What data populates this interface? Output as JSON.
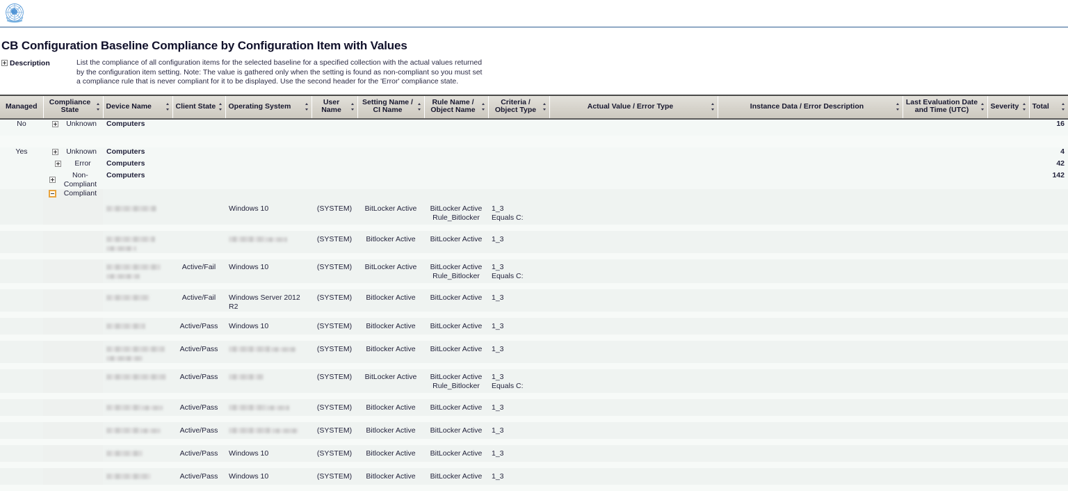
{
  "branding": {
    "logo_icon": "un-emblem-logo",
    "logo_alt": "United Nations emblem"
  },
  "report": {
    "title": "CB Configuration Baseline Compliance by Configuration Item with Values",
    "description_label": "Description",
    "description_expander_icon": "plus-box-icon",
    "description_text": "List the compliance of all configuration items for the selected baseline for a specified collection with the actual values returned by the configuration item setting. Note: The value is gathered only when the setting is found as non-compliant so you must set a compliance rule that is never compliant for it to be displayed. Use the second header for the 'Error' compliance state."
  },
  "grid": {
    "sort_icon": "sort-updown-icon",
    "columns": [
      {
        "key": "managed",
        "label": "Managed",
        "sortable": false
      },
      {
        "key": "state",
        "label": "Compliance State",
        "sortable": true
      },
      {
        "key": "device",
        "label": "Device Name",
        "sortable": true
      },
      {
        "key": "client",
        "label": "Client State",
        "sortable": true
      },
      {
        "key": "os",
        "label": "Operating System",
        "sortable": true
      },
      {
        "key": "user",
        "label": "User Name",
        "sortable": true
      },
      {
        "key": "setting",
        "label": "Setting Name / CI Name",
        "sortable": true
      },
      {
        "key": "rule",
        "label": "Rule Name / Object Name",
        "sortable": true
      },
      {
        "key": "criteria",
        "label": "Criteria / Object Type",
        "sortable": true
      },
      {
        "key": "actual",
        "label": "Actual Value / Error Type",
        "sortable": true
      },
      {
        "key": "instance",
        "label": "Instance Data / Error Description",
        "sortable": true
      },
      {
        "key": "lasteval",
        "label": "Last Evaluation Date and Time (UTC)",
        "sortable": true
      },
      {
        "key": "severity",
        "label": "Severity",
        "sortable": true
      },
      {
        "key": "total",
        "label": "Total",
        "sortable": true
      }
    ],
    "group_rows": [
      {
        "managed": "No",
        "toggle": "plus",
        "state": "Unknown",
        "device": "Computers",
        "total": "16"
      },
      {
        "managed": "Yes",
        "toggle": "plus",
        "state": "Unknown",
        "device": "Computers",
        "total": "4"
      },
      {
        "managed": "",
        "toggle": "plus",
        "state": "Error",
        "device": "Computers",
        "total": "42"
      },
      {
        "managed": "",
        "toggle": "plus",
        "state": "Non-Compliant",
        "device": "Computers",
        "total": "142"
      },
      {
        "managed": "",
        "toggle": "minus-selected",
        "state": "Compliant",
        "device": "",
        "total": ""
      }
    ],
    "detail_rows": [
      {
        "device": "redacted",
        "client": "",
        "os": "Windows 10",
        "user": "(SYSTEM)",
        "setting": "BitLocker Active",
        "rule": "BitLocker Active",
        "rule2": "Rule_Bitlocker",
        "criteria": "1_3",
        "criteria2": "Equals C:",
        "actual": "",
        "instance": "",
        "lasteval": "",
        "severity": "",
        "total": ""
      },
      {
        "device": "redacted",
        "client": "",
        "os": "redacted",
        "user": "(SYSTEM)",
        "setting": "Bitlocker Active",
        "rule": "BitLocker Active",
        "rule2": "",
        "criteria": "1_3",
        "criteria2": "",
        "actual": "",
        "instance": "",
        "lasteval": "",
        "severity": "",
        "total": ""
      },
      {
        "device": "redacted",
        "client": "Active/Fail",
        "os": "Windows 10",
        "user": "(SYSTEM)",
        "setting": "BitLocker Active",
        "rule": "BitLocker Active",
        "rule2": "Rule_Bitlocker",
        "criteria": "1_3",
        "criteria2": "Equals C:",
        "actual": "",
        "instance": "",
        "lasteval": "",
        "severity": "",
        "total": ""
      },
      {
        "device": "redacted",
        "client": "Active/Fail",
        "os": "Windows Server 2012 R2",
        "user": "(SYSTEM)",
        "setting": "Bitlocker Active",
        "rule": "BitLocker Active",
        "rule2": "",
        "criteria": "1_3",
        "criteria2": "",
        "actual": "",
        "instance": "",
        "lasteval": "",
        "severity": "",
        "total": ""
      },
      {
        "device": "redacted",
        "client": "Active/Pass",
        "os": "Windows 10",
        "user": "(SYSTEM)",
        "setting": "Bitlocker Active",
        "rule": "BitLocker Active",
        "rule2": "",
        "criteria": "1_3",
        "criteria2": "",
        "actual": "",
        "instance": "",
        "lasteval": "",
        "severity": "",
        "total": ""
      },
      {
        "device": "redacted",
        "client": "Active/Pass",
        "os": "redacted",
        "user": "(SYSTEM)",
        "setting": "Bitlocker Active",
        "rule": "BitLocker Active",
        "rule2": "",
        "criteria": "1_3",
        "criteria2": "",
        "actual": "",
        "instance": "",
        "lasteval": "",
        "severity": "",
        "total": ""
      },
      {
        "device": "redacted",
        "client": "Active/Pass",
        "os": "redacted",
        "user": "(SYSTEM)",
        "setting": "BitLocker Active",
        "rule": "BitLocker Active",
        "rule2": "Rule_Bitlocker",
        "criteria": "1_3",
        "criteria2": "Equals C:",
        "actual": "",
        "instance": "",
        "lasteval": "",
        "severity": "",
        "total": ""
      },
      {
        "device": "redacted",
        "client": "Active/Pass",
        "os": "redacted",
        "user": "(SYSTEM)",
        "setting": "Bitlocker Active",
        "rule": "BitLocker Active",
        "rule2": "",
        "criteria": "1_3",
        "criteria2": "",
        "actual": "",
        "instance": "",
        "lasteval": "",
        "severity": "",
        "total": ""
      },
      {
        "device": "redacted",
        "client": "Active/Pass",
        "os": "redacted",
        "user": "(SYSTEM)",
        "setting": "Bitlocker Active",
        "rule": "BitLocker Active",
        "rule2": "",
        "criteria": "1_3",
        "criteria2": "",
        "actual": "",
        "instance": "",
        "lasteval": "",
        "severity": "",
        "total": ""
      },
      {
        "device": "redacted",
        "client": "Active/Pass",
        "os": "Windows 10",
        "user": "(SYSTEM)",
        "setting": "Bitlocker Active",
        "rule": "BitLocker Active",
        "rule2": "",
        "criteria": "1_3",
        "criteria2": "",
        "actual": "",
        "instance": "",
        "lasteval": "",
        "severity": "",
        "total": ""
      },
      {
        "device": "redacted",
        "client": "Active/Pass",
        "os": "Windows 10",
        "user": "(SYSTEM)",
        "setting": "Bitlocker Active",
        "rule": "BitLocker Active",
        "rule2": "",
        "criteria": "1_3",
        "criteria2": "",
        "actual": "",
        "instance": "",
        "lasteval": "",
        "severity": "",
        "total": ""
      }
    ]
  },
  "colors": {
    "header_gradient_top": "#e3e1db",
    "header_gradient_bottom": "#cdc9c0",
    "stripe_a": "#eff3f1",
    "stripe_b": "#f7faf8",
    "text": "#23233c",
    "selection_highlight": "#e8a33d",
    "logo_blue": "#4a8fd4"
  }
}
